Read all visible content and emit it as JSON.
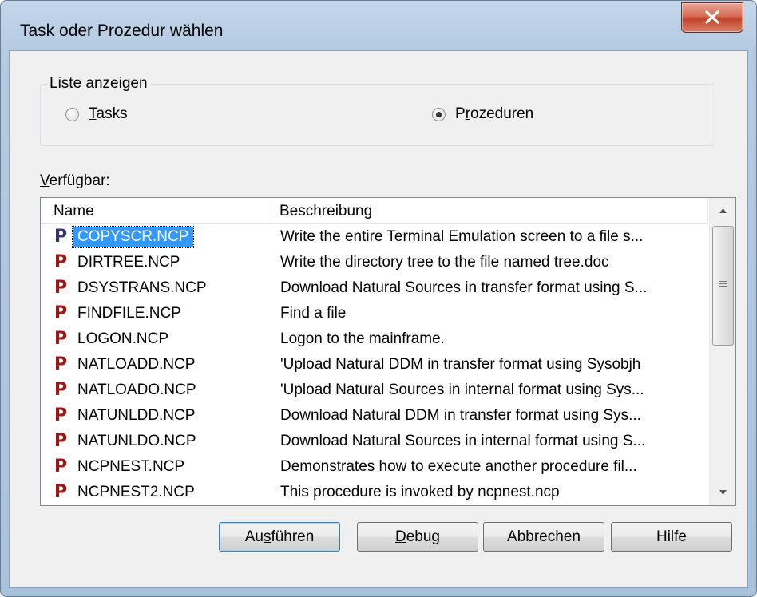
{
  "window": {
    "title": "Task oder Prozedur wählen",
    "close_icon": "close-x-icon"
  },
  "group": {
    "legend": "Liste anzeigen",
    "options": [
      {
        "label": "Tasks",
        "selected": false
      },
      {
        "label": "Prozeduren",
        "selected": true
      }
    ]
  },
  "available_label": "Verfügbar:",
  "list": {
    "columns": [
      "Name",
      "Beschreibung"
    ],
    "row_icon": "procedure-p-icon",
    "rows": [
      {
        "name": "COPYSCR.NCP",
        "description": "Write the entire Terminal Emulation screen to a file s...",
        "selected": true
      },
      {
        "name": "DIRTREE.NCP",
        "description": "Write the directory tree to the file named tree.doc"
      },
      {
        "name": "DSYSTRANS.NCP",
        "description": "Download Natural Sources in transfer format using S..."
      },
      {
        "name": "FINDFILE.NCP",
        "description": "Find a file"
      },
      {
        "name": "LOGON.NCP",
        "description": "Logon to the mainframe."
      },
      {
        "name": "NATLOADD.NCP",
        "description": "'Upload Natural DDM in transfer format using Sysobjh"
      },
      {
        "name": "NATLOADO.NCP",
        "description": "'Upload Natural Sources in internal format using Sys..."
      },
      {
        "name": "NATUNLDD.NCP",
        "description": "Download Natural DDM in transfer format using Sys..."
      },
      {
        "name": "NATUNLDO.NCP",
        "description": "Download Natural Sources in internal format using S..."
      },
      {
        "name": "NCPNEST.NCP",
        "description": "Demonstrates how to execute another procedure fil..."
      },
      {
        "name": "NCPNEST2.NCP",
        "description": "This procedure is invoked by ncpnest.ncp"
      }
    ]
  },
  "buttons": {
    "run": "Ausführen",
    "debug": "Debug",
    "cancel": "Abbrechen",
    "help": "Hilfe"
  },
  "colors": {
    "selection": "#3399ff",
    "procedure_icon": "#9a1515",
    "close_button": "#c2432a"
  }
}
